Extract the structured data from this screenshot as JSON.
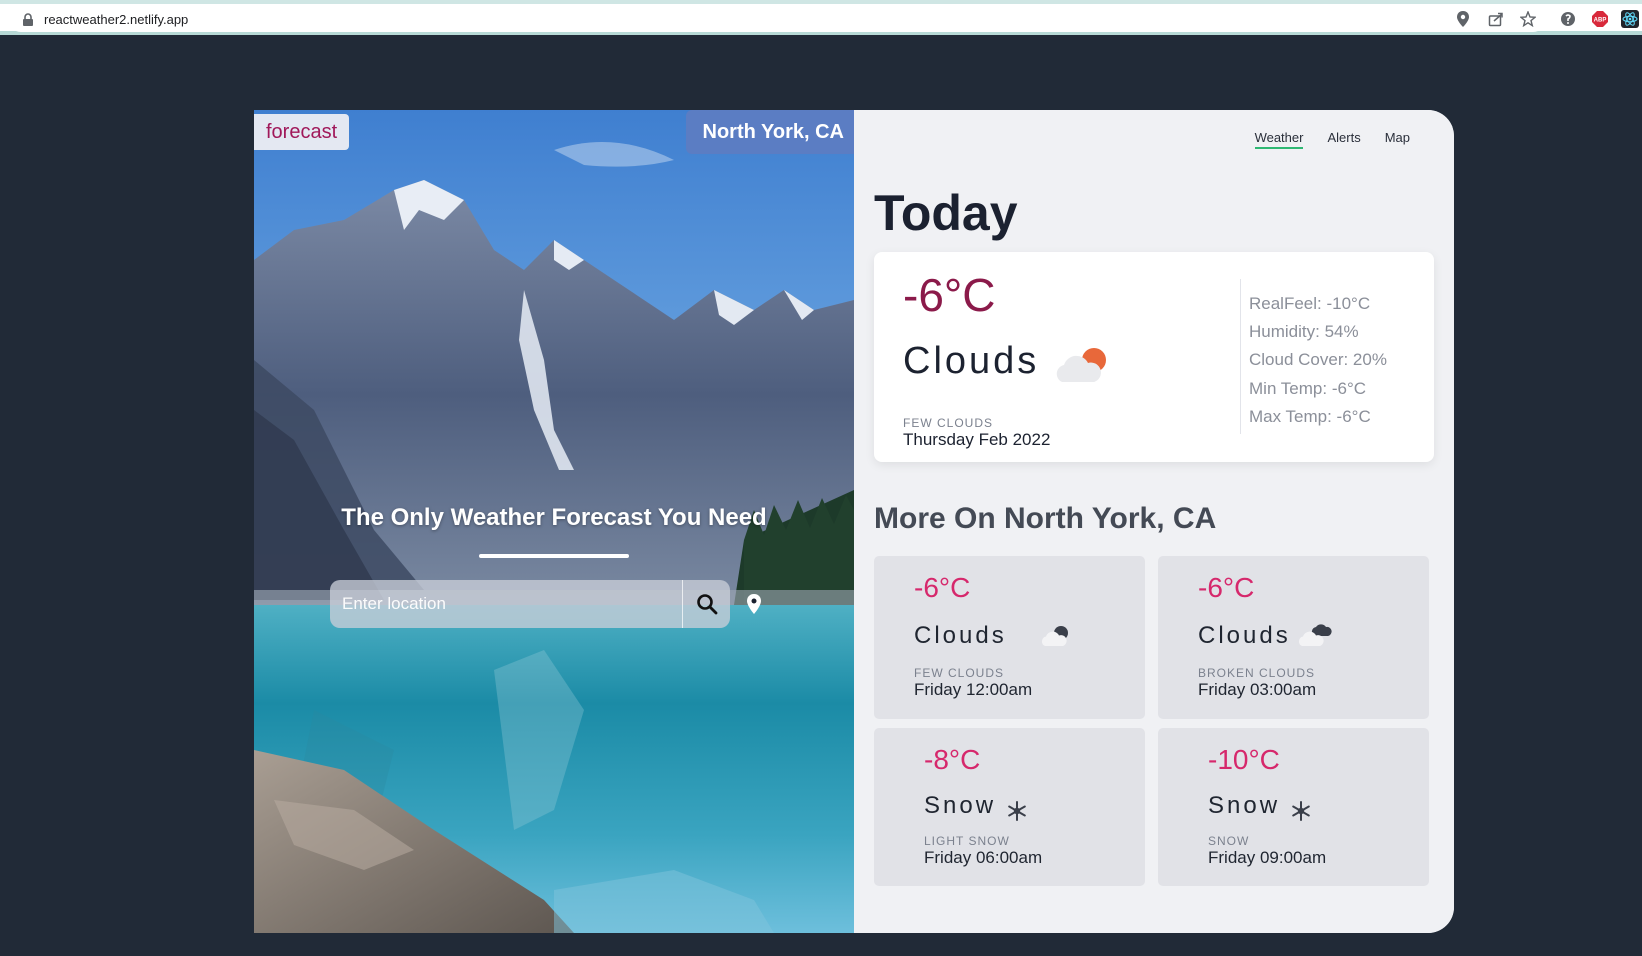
{
  "browser": {
    "url": "reactweather2.netlify.app",
    "icons": [
      "lock-icon",
      "location-icon",
      "share-icon",
      "star-icon",
      "extension-icon",
      "adblock-icon",
      "react-devtools-icon"
    ],
    "adblock_label": "ABP"
  },
  "hero": {
    "brand": "forecast",
    "location": "North York, CA",
    "tagline": "The Only Weather Forecast You Need",
    "search": {
      "placeholder": "Enter location"
    }
  },
  "nav": {
    "items": [
      "Weather",
      "Alerts",
      "Map"
    ],
    "active": "Weather"
  },
  "today": {
    "heading": "Today",
    "temp": "-6°C",
    "condition": "Clouds",
    "description": "few clouds",
    "date": "Thursday Feb 2022",
    "details": {
      "realfeel": "RealFeel: -10°C",
      "humidity": "Humidity: 54%",
      "cloud_cover": "Cloud Cover: 20%",
      "min_temp": "Min Temp: -6°C",
      "max_temp": "Max Temp: -6°C"
    }
  },
  "more": {
    "heading": "More On North York, CA",
    "cards": [
      {
        "temp": "-6°C",
        "condition": "Clouds",
        "icon": "few-clouds-night-icon",
        "description": "few clouds",
        "time": "Friday 12:00am"
      },
      {
        "temp": "-6°C",
        "condition": "Clouds",
        "icon": "broken-clouds-icon",
        "description": "broken clouds",
        "time": "Friday 03:00am"
      },
      {
        "temp": "-8°C",
        "condition": "Snow",
        "icon": "snowflake-icon",
        "description": "light snow",
        "time": "Friday 06:00am"
      },
      {
        "temp": "-10°C",
        "condition": "Snow",
        "icon": "snowflake-icon",
        "description": "snow",
        "time": "Friday 09:00am"
      }
    ]
  },
  "colors": {
    "page_bg": "#212a37",
    "accent_temp": "#d6286c",
    "today_temp": "#8b1a4a",
    "nav_active": "#2fb873",
    "location_pill": "#5b7dc3"
  }
}
